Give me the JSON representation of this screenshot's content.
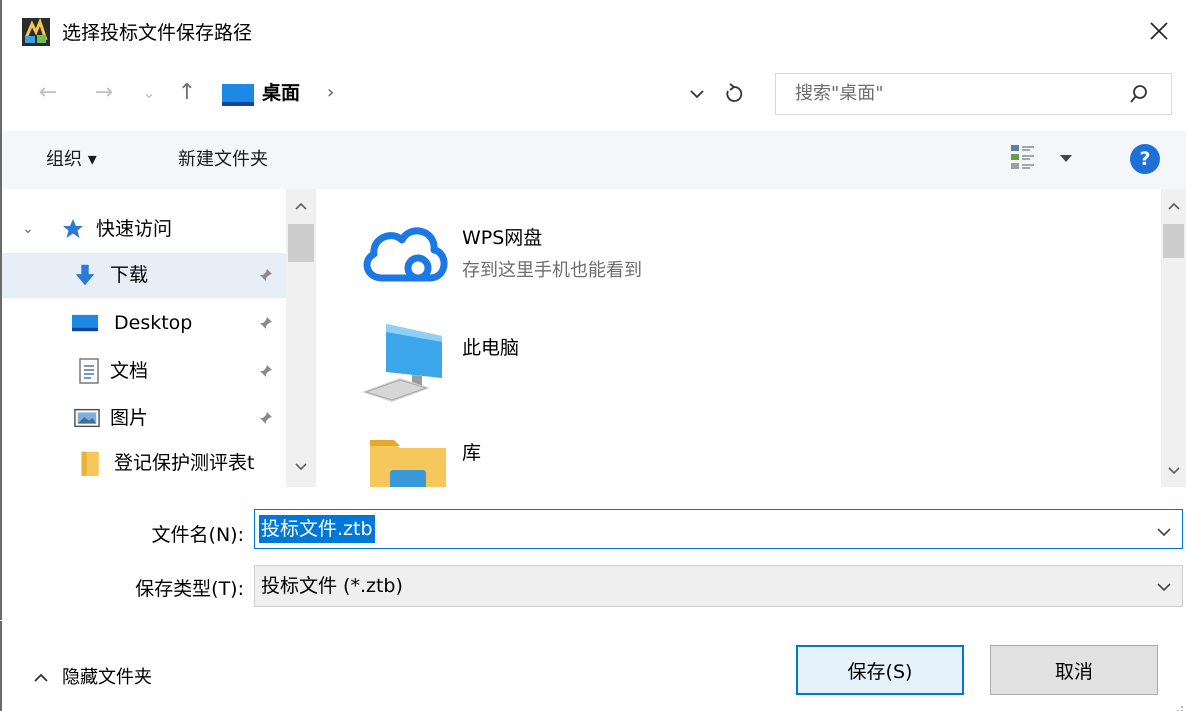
{
  "window": {
    "title": "选择投标文件保存路径",
    "icon": "app-icon",
    "close_symbol": "✕"
  },
  "nav": {
    "back_symbol": "←",
    "forward_symbol": "→",
    "recent_symbol": "⌄",
    "up_symbol": "↑",
    "address_location": "桌面",
    "address_chevron": "›",
    "search_placeholder": "搜索\"桌面\""
  },
  "toolbar": {
    "organize_label": "组织 ▾",
    "new_folder_label": "新建文件夹",
    "help_symbol": "?"
  },
  "sidebar": {
    "expand_symbol": "⌄",
    "items": [
      {
        "label": "快速访问",
        "icon": "star-icon"
      },
      {
        "label": "下载",
        "icon": "download-icon"
      },
      {
        "label": "Desktop",
        "icon": "desktop-icon"
      },
      {
        "label": "文档",
        "icon": "document-icon"
      },
      {
        "label": "图片",
        "icon": "pictures-icon"
      },
      {
        "label": "登记保护测评表t",
        "icon": "folder-icon"
      }
    ]
  },
  "content": {
    "items": [
      {
        "title": "WPS网盘",
        "subtitle": "存到这里手机也能看到",
        "icon": "cloud-icon"
      },
      {
        "title": "此电脑",
        "icon": "computer-icon"
      },
      {
        "title": "库",
        "icon": "library-folder-icon"
      }
    ]
  },
  "form": {
    "filename_label": "文件名(N):",
    "filename_value": "投标文件.ztb",
    "filetype_label": "保存类型(T):",
    "filetype_value": "投标文件 (*.ztb)"
  },
  "footer": {
    "hide_folders_label": "隐藏文件夹",
    "save_label": "保存(S)",
    "cancel_label": "取消"
  },
  "colors": {
    "accent": "#0078d7",
    "toolbar_bg": "#f4f6fa",
    "selected_bg": "#e7eef8",
    "help_blue": "#1e6fd6"
  }
}
